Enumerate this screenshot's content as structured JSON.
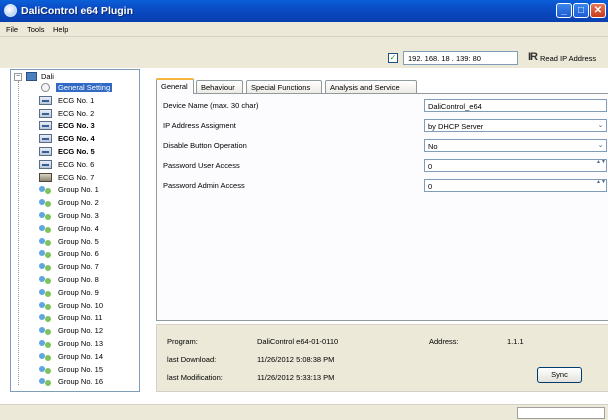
{
  "window": {
    "title": "DaliControl e64 Plugin",
    "min": "_",
    "max": "□",
    "close": "✕"
  },
  "menu": [
    "File",
    "Tools",
    "Help"
  ],
  "toolbar": {
    "ip_checked": "✓",
    "ip_address": "192. 168. 18 . 139: 80",
    "read_ip_label": "Read IP Address",
    "read_ip_icon": "IR"
  },
  "tree": {
    "root": "Dali",
    "items": [
      {
        "label": "General Setting",
        "icon": "general-setting-icon",
        "selected": true,
        "bold": false
      },
      {
        "label": "ECG No. 1",
        "icon": "ecg-icon",
        "bold": false
      },
      {
        "label": "ECG No. 2",
        "icon": "ecg-icon",
        "bold": false
      },
      {
        "label": "ECG No. 3",
        "icon": "ecg-icon",
        "bold": true
      },
      {
        "label": "ECG No. 4",
        "icon": "ecg-icon",
        "bold": true
      },
      {
        "label": "ECG No. 5",
        "icon": "ecg-icon",
        "bold": true
      },
      {
        "label": "ECG No. 6",
        "icon": "ecg-icon",
        "bold": false
      },
      {
        "label": "ECG No. 7",
        "icon": "ecg-lamp-icon",
        "bold": false
      },
      {
        "label": "Group No. 1",
        "icon": "group-icon"
      },
      {
        "label": "Group No. 2",
        "icon": "group-icon"
      },
      {
        "label": "Group No. 3",
        "icon": "group-icon"
      },
      {
        "label": "Group No. 4",
        "icon": "group-icon"
      },
      {
        "label": "Group No. 5",
        "icon": "group-icon"
      },
      {
        "label": "Group No. 6",
        "icon": "group-icon"
      },
      {
        "label": "Group No. 7",
        "icon": "group-icon"
      },
      {
        "label": "Group No. 8",
        "icon": "group-icon"
      },
      {
        "label": "Group No. 9",
        "icon": "group-icon"
      },
      {
        "label": "Group No. 10",
        "icon": "group-icon"
      },
      {
        "label": "Group No. 11",
        "icon": "group-icon"
      },
      {
        "label": "Group No. 12",
        "icon": "group-icon"
      },
      {
        "label": "Group No. 13",
        "icon": "group-icon"
      },
      {
        "label": "Group No. 14",
        "icon": "group-icon"
      },
      {
        "label": "Group No. 15",
        "icon": "group-icon"
      },
      {
        "label": "Group No. 16",
        "icon": "group-icon"
      }
    ]
  },
  "tabs": [
    "General",
    "Behaviour",
    "Special Functions",
    "Analysis and Service"
  ],
  "form": {
    "device_name_label": "Device Name (max. 30 char)",
    "device_name_value": "DaliControl_e64",
    "ip_assign_label": "IP Address Assigment",
    "ip_assign_value": "by DHCP Server",
    "disable_btn_label": "Disable Button Operation",
    "disable_btn_value": "No",
    "pw_user_label": "Password User Access",
    "pw_user_value": "0",
    "pw_admin_label": "Password Admin Access",
    "pw_admin_value": "0",
    "dropdown_arrow": "⌄",
    "spin_arrows": "▲▼"
  },
  "info": {
    "program_label": "Program:",
    "program_value": "DaliControl  e64-01-0110",
    "address_label": "Address:",
    "address_value": "1.1.1",
    "last_download_label": "last Download:",
    "last_download_value": "11/26/2012 5:08:38 PM",
    "last_mod_label": "last Modification:",
    "last_mod_value": "11/26/2012 5:33:13 PM",
    "sync_label": "Sync"
  },
  "colors": {
    "titlebar": "#0a4bc4",
    "selection": "#316ac5",
    "active_tab_accent": "#f5b53f",
    "chrome": "#ece9d8"
  }
}
